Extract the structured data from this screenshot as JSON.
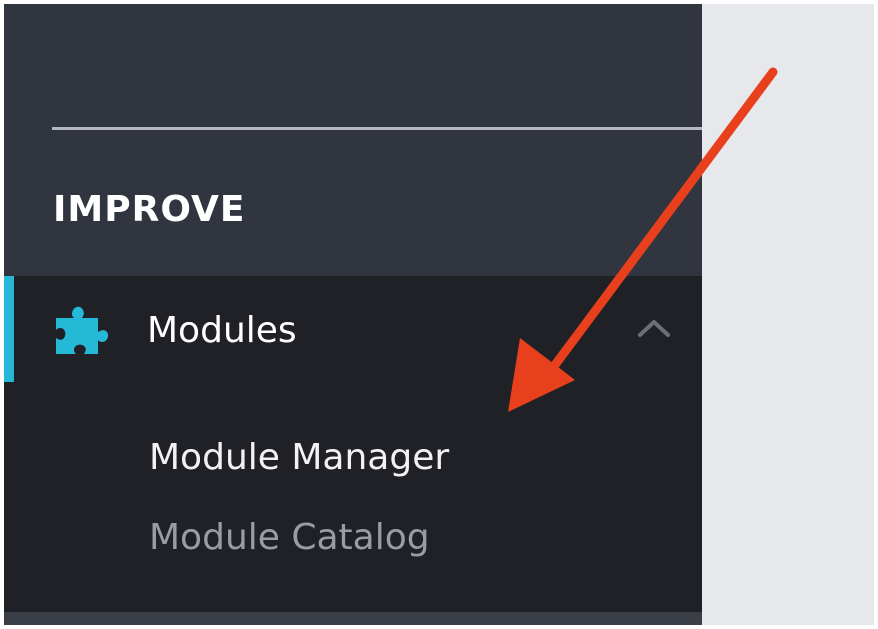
{
  "sidebar": {
    "section_title": "IMPROVE",
    "active_item": {
      "label": "Modules",
      "icon": "puzzle-piece-icon",
      "expanded_icon": "chevron-up-icon",
      "sub_items": [
        {
          "label": "Module Manager"
        },
        {
          "label": "Module Catalog"
        }
      ]
    }
  },
  "annotation": {
    "type": "arrow",
    "points_to": "Module Manager",
    "color": "#e8401c"
  },
  "colors": {
    "sidebar_bg": "#313540",
    "submenu_bg": "#1f2126",
    "accent": "#25b9d7",
    "content_bg": "#e7e8eb"
  }
}
